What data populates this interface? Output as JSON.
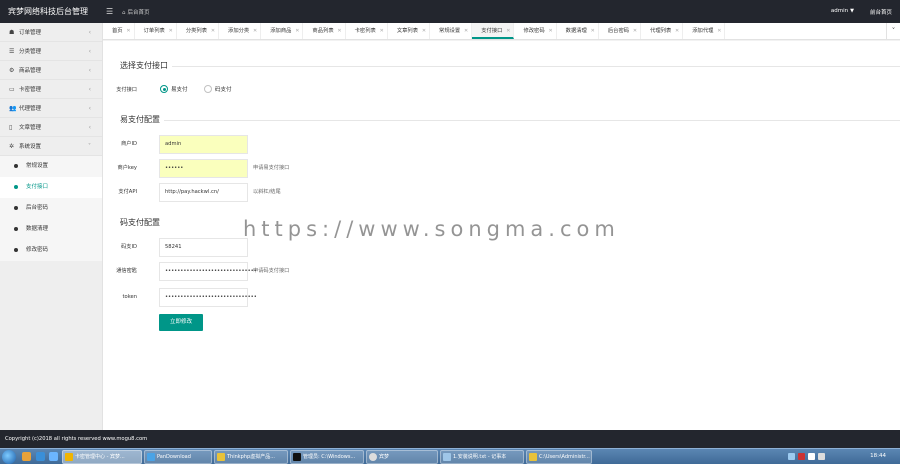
{
  "header": {
    "brand": "宾梦网络科技后台管理",
    "menu_icon": "menu-icon",
    "home_label": "后台首页",
    "user": "admin",
    "frontend": "前台首页"
  },
  "sidebar": {
    "items": [
      {
        "icon": "☗",
        "icon_name": "order-icon",
        "label": "订单管理"
      },
      {
        "icon": "☰",
        "icon_name": "list-icon",
        "label": "分类管理"
      },
      {
        "icon": "⚙",
        "icon_name": "product-icon",
        "label": "商品管理"
      },
      {
        "icon": "▭",
        "icon_name": "card-icon",
        "label": "卡密管理"
      },
      {
        "icon": "👥",
        "icon_name": "users-icon",
        "label": "代理管理"
      },
      {
        "icon": "▯",
        "icon_name": "document-icon",
        "label": "文章管理"
      },
      {
        "icon": "✲",
        "icon_name": "settings-icon",
        "label": "系统设置"
      }
    ],
    "sub_items": [
      {
        "label": "常规设置"
      },
      {
        "label": "支付接口"
      },
      {
        "label": "后台密码"
      },
      {
        "label": "数据清理"
      },
      {
        "label": "修改密码"
      }
    ]
  },
  "tabs": [
    {
      "label": "首页"
    },
    {
      "label": "订单列表"
    },
    {
      "label": "分类列表"
    },
    {
      "label": "添加分类"
    },
    {
      "label": "添加商品"
    },
    {
      "label": "商品列表"
    },
    {
      "label": "卡密列表"
    },
    {
      "label": "文章列表"
    },
    {
      "label": "常规设置"
    },
    {
      "label": "支付接口"
    },
    {
      "label": "修改密码"
    },
    {
      "label": "数据清理"
    },
    {
      "label": "后台密码"
    },
    {
      "label": "代理列表"
    },
    {
      "label": "添加代理"
    }
  ],
  "form": {
    "section_select": "选择支付接口",
    "pay_label": "支付接口",
    "radio_epay": "易支付",
    "radio_mapay": "码支付",
    "section_epay": "易支付配置",
    "merchant_id_label": "商户ID",
    "merchant_id_value": "admin",
    "merchant_key_label": "商户key",
    "merchant_key_value": "••••••",
    "merchant_key_hint": "申请易支付接口",
    "api_label": "支付API",
    "api_value": "http://pay.hackwl.cn/",
    "api_hint": "以斜杠/结尾",
    "section_mapay": "码支付配置",
    "code_id_label": "码支ID",
    "code_id_value": "58241",
    "comm_key_label": "通信密匙",
    "comm_key_value": "••••••••••••••••••••••••••••••",
    "comm_key_hint": "申请码支付接口",
    "token_label": "token",
    "token_value": "••••••••••••••••••••••••••••••",
    "submit": "立即修改"
  },
  "watermark": "https://www.songma.com",
  "footer": "Copyright (c)2018 all rights reserved www.mogu8.com",
  "taskbar": {
    "tasks": [
      {
        "label": "卡密管理中心 - 宾梦..."
      },
      {
        "label": "PanDownload"
      },
      {
        "label": "Thinkphp虚拟产品..."
      },
      {
        "label": "管理员: C:\\Windows..."
      },
      {
        "label": "宾梦"
      },
      {
        "label": "1.安装说明.txt - 记事本"
      },
      {
        "label": "C:\\Users\\Administr..."
      }
    ],
    "clock": "18:44"
  }
}
